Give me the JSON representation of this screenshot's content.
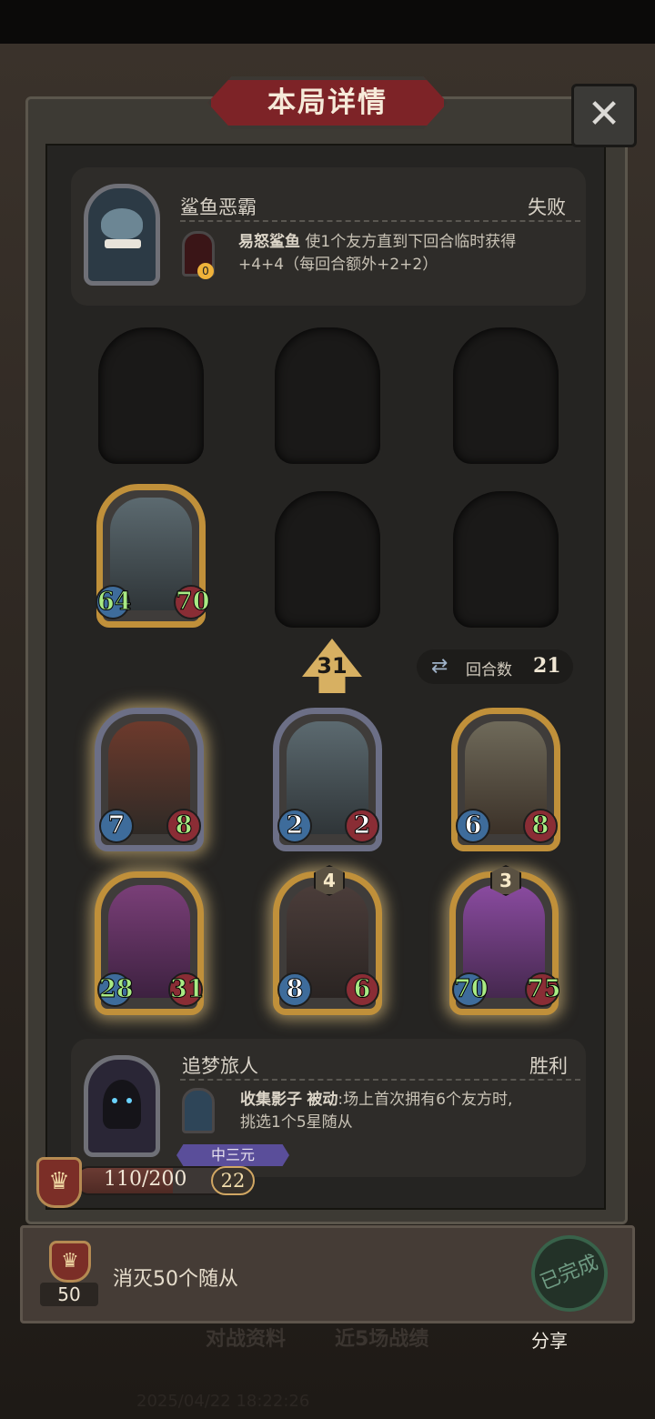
{
  "window": {
    "title": "本局详情",
    "close_icon": "close-icon"
  },
  "opponent": {
    "name": "鲨鱼恶霸",
    "result": "失败",
    "minion_count": "0",
    "skill_name": "易怒鲨鱼",
    "skill_desc_line1": "使1个友方直到下回合临时获得",
    "skill_desc_line2": "+4+4（每回合额外+2+2）"
  },
  "opponent_board": [
    {
      "attack": "64",
      "health": "70",
      "frame": "gold"
    }
  ],
  "round": {
    "upgrade_cost": "31",
    "label": "回合数",
    "value": "21",
    "icon": "swap-icon"
  },
  "player_board": [
    {
      "attack": "7",
      "health": "8",
      "frame": "silver",
      "tier": ""
    },
    {
      "attack": "2",
      "health": "2",
      "frame": "silver",
      "tier": ""
    },
    {
      "attack": "6",
      "health": "8",
      "frame": "gold",
      "tier": ""
    },
    {
      "attack": "28",
      "health": "31",
      "frame": "gold",
      "tier": ""
    },
    {
      "attack": "8",
      "health": "6",
      "frame": "gold",
      "tier": "4"
    },
    {
      "attack": "70",
      "health": "75",
      "frame": "gold",
      "tier": "3"
    }
  ],
  "player": {
    "name": "追梦旅人",
    "result": "胜利",
    "skill_name": "收集影子",
    "skill_type": "被动",
    "skill_desc_line1": ":场上首次拥有6个友方时,",
    "skill_desc_line2": "挑选1个5星随从",
    "rank_badge": "中三元",
    "xp": "110/200",
    "xp_progress": 0.55,
    "level": "22"
  },
  "mission": {
    "count": "50",
    "text": "消灭50个随从",
    "stamp": "已完成",
    "share": "分享"
  },
  "tabs": {
    "tab1": "对战资料",
    "tab2": "近5场战绩",
    "footer": "2025/04/22 18:22:26"
  }
}
